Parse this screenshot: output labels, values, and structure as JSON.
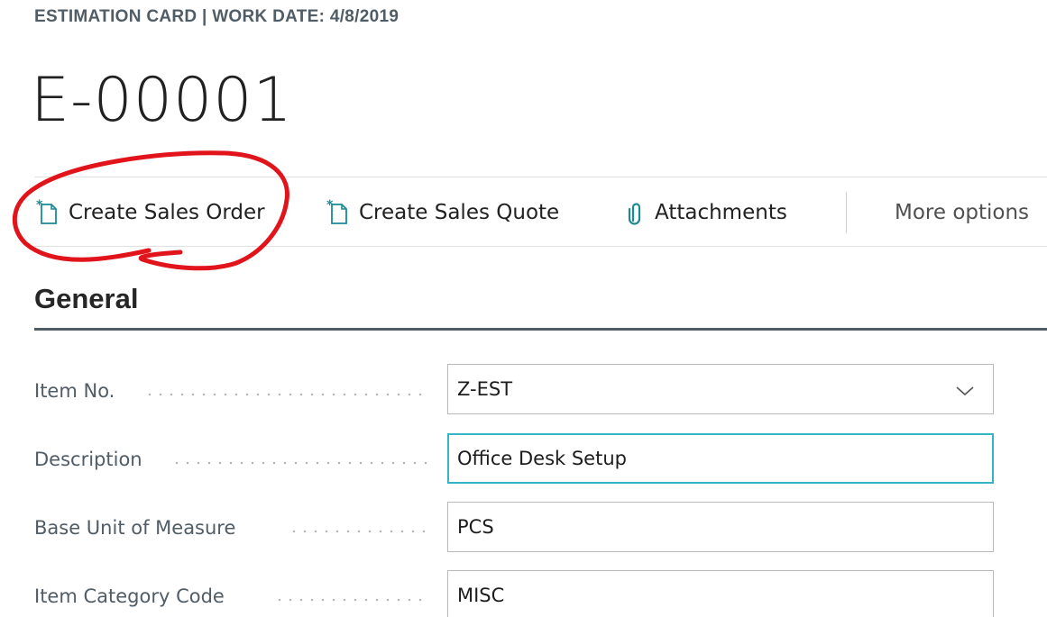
{
  "header": {
    "caption": "ESTIMATION CARD | WORK DATE: 4/8/2019",
    "title": "E-00001"
  },
  "actions": {
    "create_sales_order": "Create Sales Order",
    "create_sales_quote": "Create Sales Quote",
    "attachments": "Attachments",
    "more_options": "More options"
  },
  "section": {
    "title": "General"
  },
  "fields": [
    {
      "label": "Item No.",
      "value": "Z-EST"
    },
    {
      "label": "Description",
      "value": "Office Desk Setup"
    },
    {
      "label": "Base Unit of Measure",
      "value": "PCS"
    },
    {
      "label": "Item Category Code",
      "value": "MISC"
    }
  ],
  "colors": {
    "accent": "#33b5c2",
    "icon_teal": "#1a8a95",
    "annotation": "#e0141a",
    "header_text": "#505c66"
  },
  "icons": {
    "new_document": "new-document-icon",
    "attachment": "paperclip-icon",
    "dropdown": "chevron-down-icon"
  }
}
